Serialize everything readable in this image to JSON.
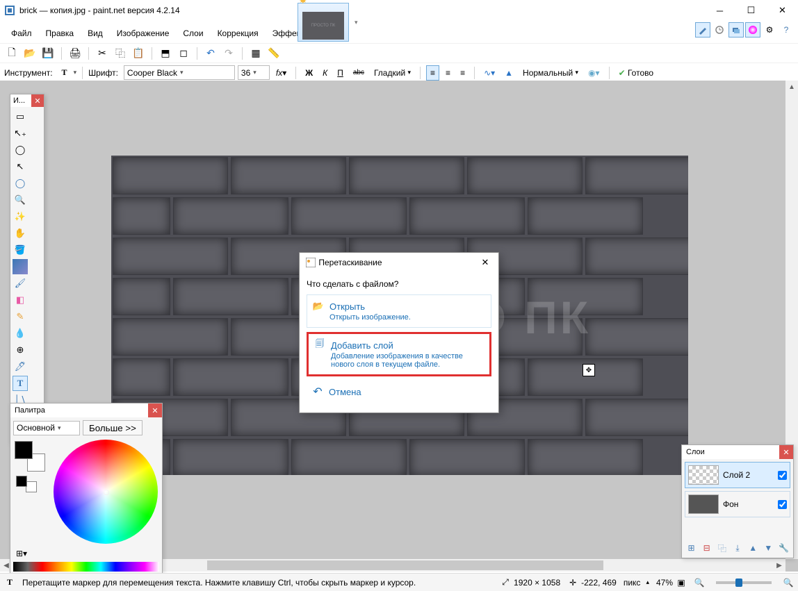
{
  "window": {
    "title": "brick — копия.jpg - paint.net версия 4.2.14",
    "thumb_label": "ПРОСТО ПК"
  },
  "menu": {
    "file": "Файл",
    "edit": "Правка",
    "view": "Вид",
    "image": "Изображение",
    "layers": "Слои",
    "adjust": "Коррекция",
    "effects": "Эффекты"
  },
  "toolbar": {
    "instrument_label": "Инструмент:",
    "font_label": "Шрифт:",
    "font_name": "Cooper Black",
    "font_size": "36",
    "bold": "Ж",
    "italic": "К",
    "underline": "П",
    "strike": "abc",
    "render_label": "Гладкий",
    "blend_label": "Нормальный",
    "done": "Готово"
  },
  "toolbox": {
    "title": "И..."
  },
  "palette": {
    "title": "Палитра",
    "mode": "Основной",
    "more": "Больше >>"
  },
  "layers_panel": {
    "title": "Слои",
    "items": [
      {
        "name": "Слой 2",
        "checked": true
      },
      {
        "name": "Фон",
        "checked": true
      }
    ]
  },
  "dialog": {
    "title": "Перетаскивание",
    "question": "Что сделать с файлом?",
    "open": {
      "title": "Открыть",
      "desc": "Открыть изображение."
    },
    "addlayer": {
      "title": "Добавить слой",
      "desc": "Добавление изображения в качестве нового слоя в текущем файле."
    },
    "cancel": "Отмена"
  },
  "status": {
    "hint": "Перетащите маркер для перемещения текста. Нажмите клавишу Ctrl, чтобы скрыть маркер и курсор.",
    "dims": "1920 × 1058",
    "cursor": "-222, 469",
    "unit": "пикс",
    "zoom": "47%"
  },
  "canvas": {
    "watermark": "ПРОСТО ПК"
  }
}
